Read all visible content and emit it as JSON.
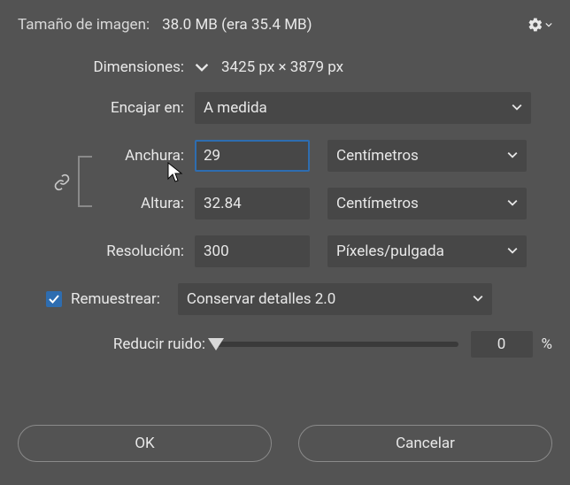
{
  "header": {
    "label": "Tamaño de imagen:",
    "value": "38.0 MB (era 35.4 MB)"
  },
  "dimensions": {
    "label": "Dimensiones:",
    "value": "3425 px × 3879 px"
  },
  "fit": {
    "label": "Encajar en:",
    "value": "A medida"
  },
  "width": {
    "label": "Anchura:",
    "value": "29",
    "unit": "Centímetros"
  },
  "height": {
    "label": "Altura:",
    "value": "32.84",
    "unit": "Centímetros"
  },
  "resolution": {
    "label": "Resolución:",
    "value": "300",
    "unit": "Píxeles/pulgada"
  },
  "resample": {
    "label": "Remuestrear:",
    "checked": true,
    "method": "Conservar detalles 2.0"
  },
  "noise": {
    "label": "Reducir ruido:",
    "value": "0",
    "suffix": "%"
  },
  "buttons": {
    "ok": "OK",
    "cancel": "Cancelar"
  }
}
